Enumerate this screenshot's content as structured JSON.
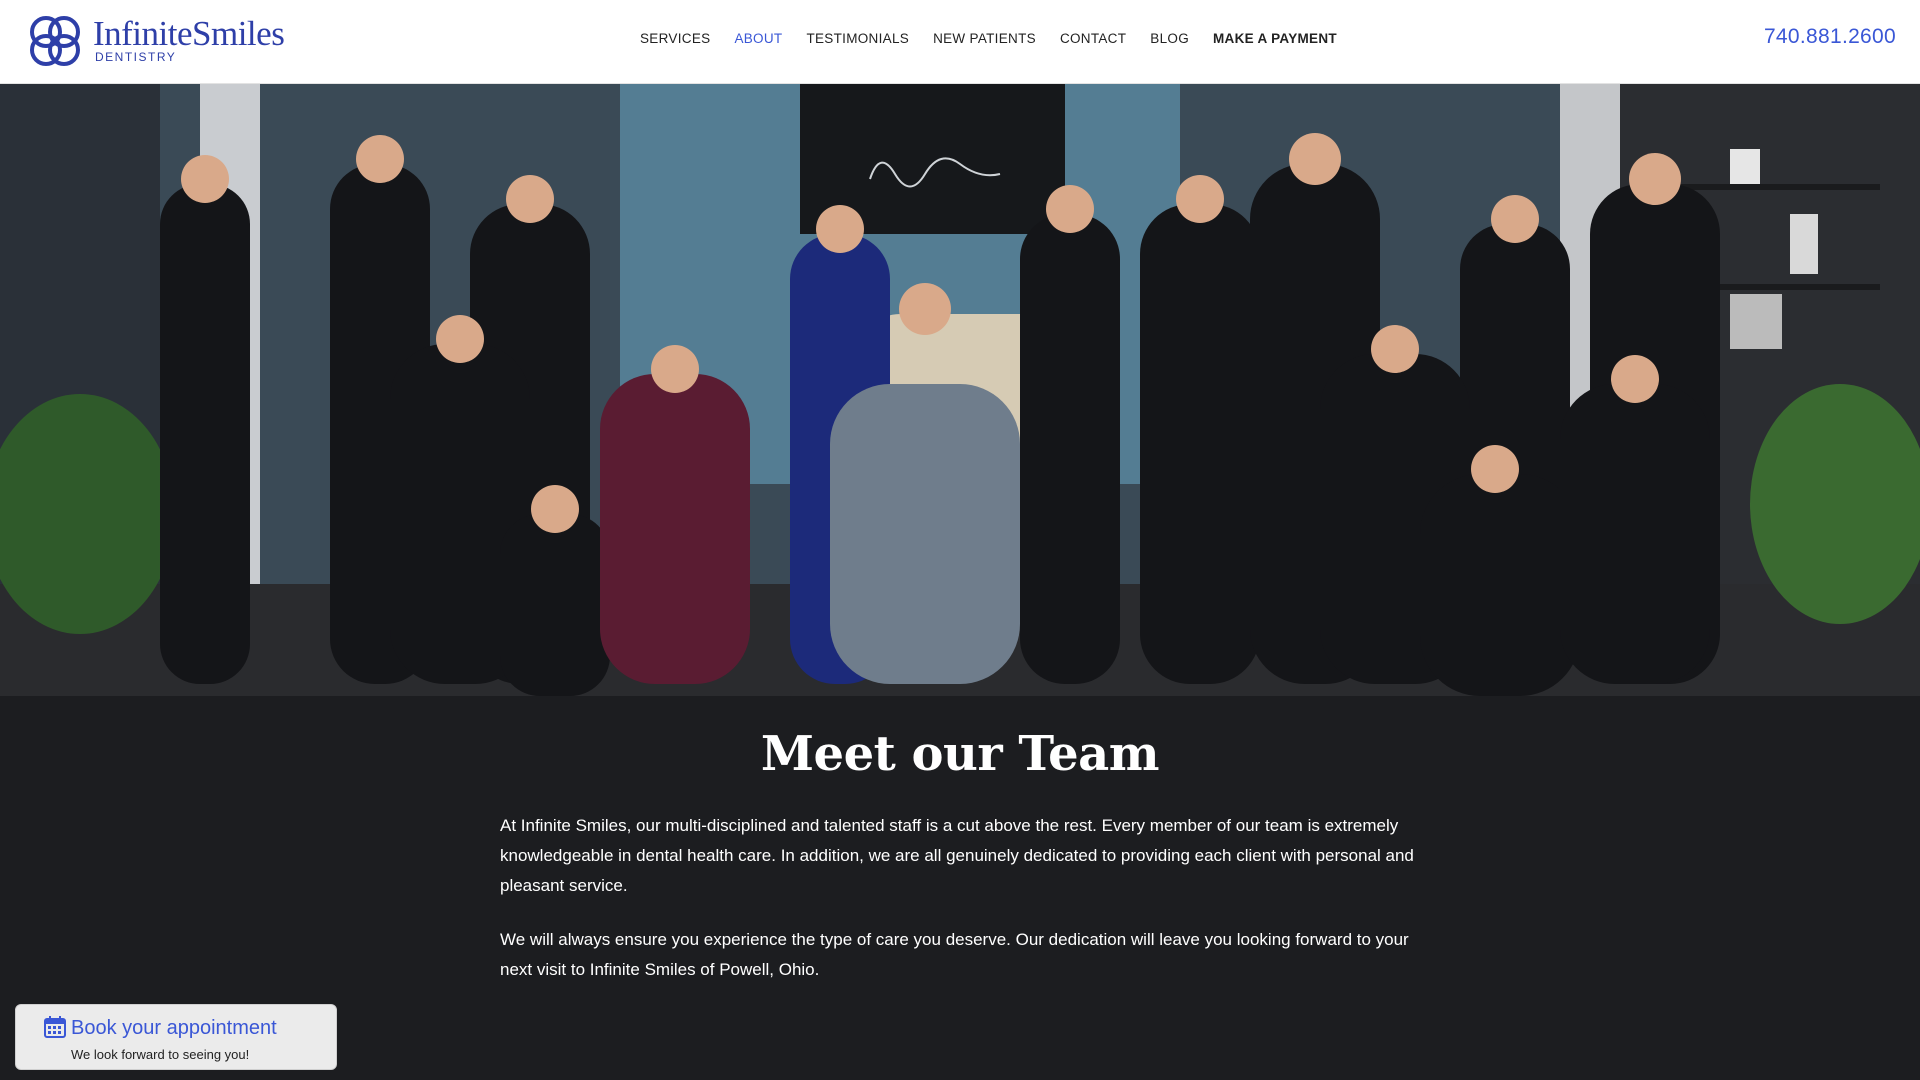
{
  "brand": {
    "name": "InfiniteSmiles",
    "sub": "DENTISTRY",
    "color": "#2e3fa8"
  },
  "nav": {
    "items": [
      {
        "label": "SERVICES"
      },
      {
        "label": "ABOUT"
      },
      {
        "label": "TESTIMONIALS"
      },
      {
        "label": "NEW PATIENTS"
      },
      {
        "label": "CONTACT"
      },
      {
        "label": "BLOG"
      },
      {
        "label": "MAKE A PAYMENT"
      }
    ],
    "active": "ABOUT",
    "active_color": "#3a57d6"
  },
  "phone": "740.881.2600",
  "hero": {
    "icon": "team-photo"
  },
  "main": {
    "title": "Meet our Team",
    "paragraphs": [
      "At Infinite Smiles, our multi-disciplined and talented staff is a cut above the rest. Every member of our team is extremely knowledgeable in dental health care. In addition, we are all genuinely dedicated to providing each client with personal and pleasant service.",
      "We will always ensure you experience the type of care you deserve. Our dedication will leave you looking forward to your next visit to Infinite Smiles of Powell, Ohio."
    ]
  },
  "booking": {
    "title": "Book your appointment",
    "subtitle": "We look forward to seeing you!",
    "icon": "calendar-icon"
  },
  "colors": {
    "background": "#1c1d20",
    "accent": "#3a57d6"
  }
}
